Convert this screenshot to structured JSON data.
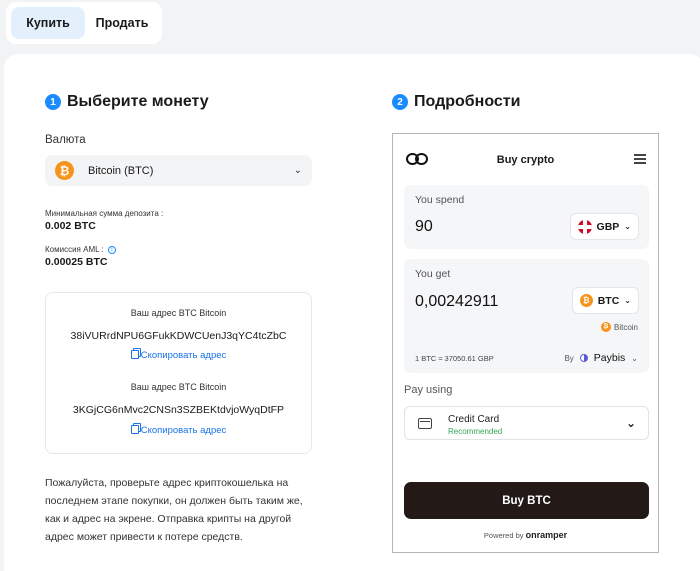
{
  "tabs": {
    "buy": "Купить",
    "sell": "Продать"
  },
  "step1": {
    "num": "1",
    "title": "Выберите монету"
  },
  "step2": {
    "num": "2",
    "title": "Подробности"
  },
  "currency": {
    "label": "Валюта",
    "selected": "Bitcoin (BTC)",
    "icon_glyph": "₿"
  },
  "min_deposit": {
    "label": "Минимальная сумма депозита :",
    "value": "0.002 BTC"
  },
  "aml_fee": {
    "label": "Комиссия AML :",
    "info": "i",
    "value": "0.00025 BTC"
  },
  "addresses": [
    {
      "title": "Ваш адрес BTC Bitcoin",
      "address": "38iVURrdNPU6GFukKDWCUenJ3qYC4tcZbC",
      "copy": "Скопировать адрес"
    },
    {
      "title": "Ваш адрес BTC Bitcoin",
      "address": "3KGjCG6nMvc2CNSn3SZBEKtdvjoWyqDtFP",
      "copy": "Скопировать адрес"
    }
  ],
  "note": "Пожалуйста, проверьте адрес криптокошелька на последнем этапе покупки, он должен быть таким же, как и адрес на экрене. Отправка крипты на другой адрес может привести к потере средств.",
  "widget": {
    "title": "Buy crypto",
    "spend": {
      "label": "You spend",
      "amount": "90",
      "currency": "GBP"
    },
    "get": {
      "label": "You get",
      "amount": "0,00242911",
      "currency": "BTC",
      "network": "Bitcoin"
    },
    "rate": "1 BTC ≈ 37050.61 GBP",
    "by": {
      "label": "By",
      "provider": "Paybis"
    },
    "pay": {
      "label": "Pay using",
      "method": "Credit Card",
      "tag": "Recommended"
    },
    "buy_button": "Buy BTC",
    "powered": {
      "label": "Powered by",
      "brand": "onramper"
    }
  },
  "colors": {
    "accent": "#1a8cff",
    "btc": "#f7931a",
    "buy_button": "#231a17",
    "recommended": "#37a45a"
  }
}
